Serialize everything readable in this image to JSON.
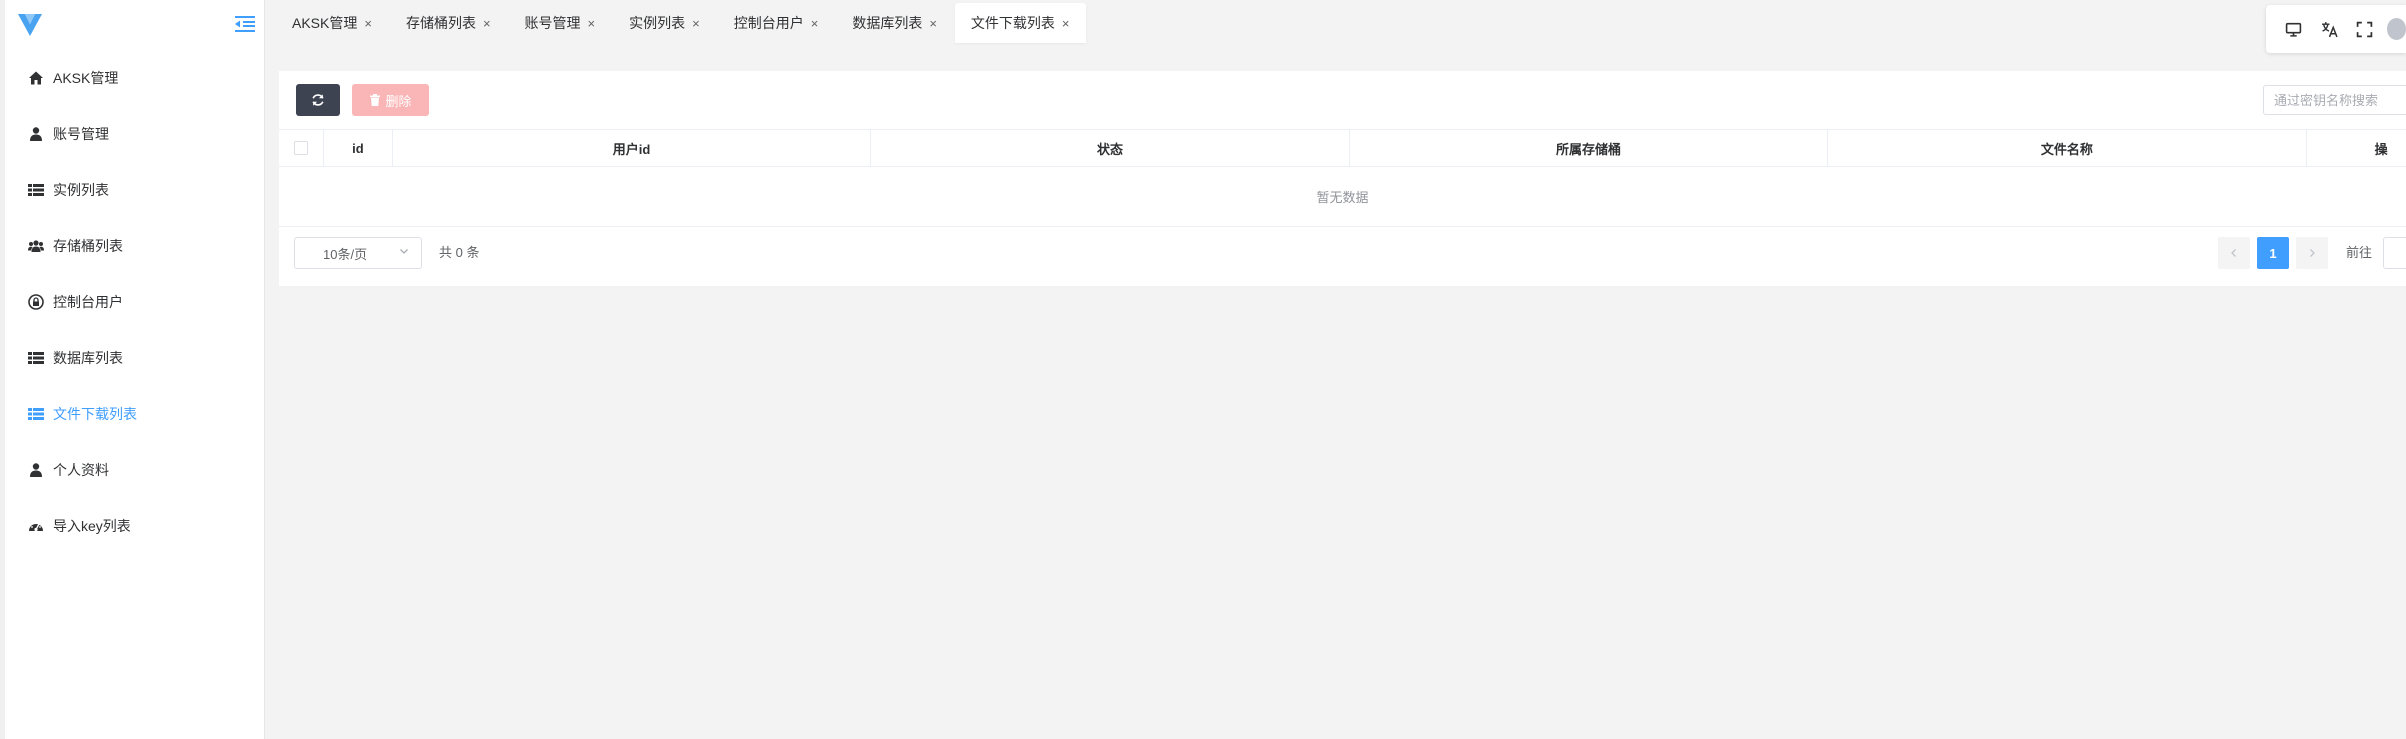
{
  "sidebar": {
    "items": [
      {
        "label": "AKSK管理",
        "icon": "home-icon"
      },
      {
        "label": "账号管理",
        "icon": "user-icon"
      },
      {
        "label": "实例列表",
        "icon": "list-icon"
      },
      {
        "label": "存储桶列表",
        "icon": "users-icon"
      },
      {
        "label": "控制台用户",
        "icon": "lock-icon"
      },
      {
        "label": "数据库列表",
        "icon": "list-icon"
      },
      {
        "label": "文件下载列表",
        "icon": "list-icon",
        "active": true
      },
      {
        "label": "个人资料",
        "icon": "user-icon"
      },
      {
        "label": "导入key列表",
        "icon": "dashboard-icon"
      }
    ]
  },
  "tabs": [
    {
      "label": "AKSK管理"
    },
    {
      "label": "存储桶列表"
    },
    {
      "label": "账号管理"
    },
    {
      "label": "实例列表"
    },
    {
      "label": "控制台用户"
    },
    {
      "label": "数据库列表"
    },
    {
      "label": "文件下载列表",
      "active": true
    }
  ],
  "toolbar": {
    "delete_label": "删除",
    "search_placeholder": "通过密钥名称搜索"
  },
  "table": {
    "columns": [
      "id",
      "用户id",
      "状态",
      "所属存储桶",
      "文件名称",
      "操"
    ],
    "empty_text": "暂无数据"
  },
  "pagination": {
    "page_size": "10条/页",
    "total": "共 0 条",
    "current_page": "1",
    "goto_label": "前往"
  },
  "colors": {
    "accent": "#409eff",
    "refresh_button": "#3e4352",
    "delete_button": "#fab6b6"
  }
}
